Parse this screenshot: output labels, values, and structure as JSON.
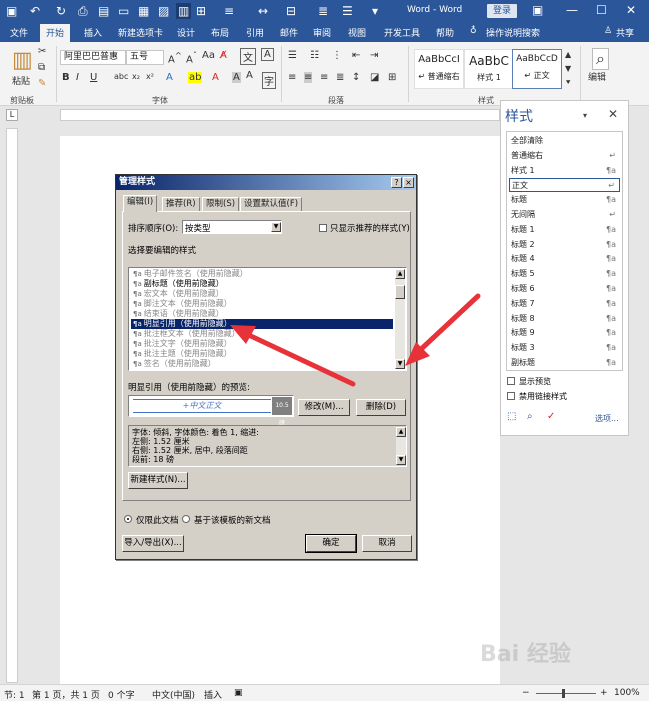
{
  "titlebar": {
    "title": "Word - Word",
    "login": "登录"
  },
  "menu": {
    "tabs": [
      "文件",
      "开始",
      "插入",
      "新建选项卡",
      "设计",
      "布局",
      "引用",
      "邮件",
      "审阅",
      "视图",
      "开发工具",
      "帮助"
    ],
    "active": "开始",
    "tell_me": "操作说明搜索",
    "share": "共享"
  },
  "ribbon": {
    "paste": "粘贴",
    "clipboard": "剪贴板",
    "font_name": "阿里巴巴普惠",
    "font_size": "五号",
    "font_group": "字体",
    "paragraph_group": "段落",
    "styles_group": "样式",
    "edit": "编辑",
    "style_gallery": [
      {
        "preview": "AaBbCcI",
        "name": "↵ 普通缩右"
      },
      {
        "preview": "AaBbC",
        "name": "样式 1"
      },
      {
        "preview": "AaBbCcD",
        "name": "↵ 正文"
      }
    ]
  },
  "styles_pane": {
    "title": "样式",
    "items": [
      {
        "label": "全部清除",
        "mark": ""
      },
      {
        "label": "普通缩右",
        "mark": "↵"
      },
      {
        "label": "样式 1",
        "mark": "¶a"
      },
      {
        "label": "正文",
        "mark": "↵"
      },
      {
        "label": "标题",
        "mark": "¶a"
      },
      {
        "label": "无间隔",
        "mark": "↵"
      },
      {
        "label": "标题 1",
        "mark": "¶a"
      },
      {
        "label": "标题 2",
        "mark": "¶a"
      },
      {
        "label": "标题 4",
        "mark": "¶a"
      },
      {
        "label": "标题 5",
        "mark": "¶a"
      },
      {
        "label": "标题 6",
        "mark": "¶a"
      },
      {
        "label": "标题 7",
        "mark": "¶a"
      },
      {
        "label": "标题 8",
        "mark": "¶a"
      },
      {
        "label": "标题 9",
        "mark": "¶a"
      },
      {
        "label": "标题 3",
        "mark": "¶a"
      },
      {
        "label": "副标题",
        "mark": "¶a"
      }
    ],
    "selected_index": 3,
    "show_preview": "显示预览",
    "disable_linked": "禁用链接样式",
    "options": "选项..."
  },
  "dialog": {
    "title": "管理样式",
    "tabs": [
      "编辑(I)",
      "推荐(R)",
      "限制(S)",
      "设置默认值(F)"
    ],
    "sort_label": "排序顺序(O):",
    "sort_value": "按类型",
    "only_recommended": "只显示推荐的样式(Y)",
    "select_label": "选择要编辑的样式",
    "style_items": [
      {
        "label": "电子邮件签名（使用前隐藏）",
        "state": "grey"
      },
      {
        "label": "副标题（使用前隐藏）",
        "state": "black"
      },
      {
        "label": "宏文本（使用前隐藏）",
        "state": "grey"
      },
      {
        "label": "脚注文本（使用前隐藏）",
        "state": "grey"
      },
      {
        "label": "结束语（使用前隐藏）",
        "state": "grey"
      },
      {
        "label": "明显引用（使用前隐藏）",
        "state": "selected"
      },
      {
        "label": "批注框文本（使用前隐藏）",
        "state": "grey"
      },
      {
        "label": "批注文字（使用前隐藏）",
        "state": "grey"
      },
      {
        "label": "批注主题（使用前隐藏）",
        "state": "grey"
      },
      {
        "label": "签名（使用前隐藏）",
        "state": "grey"
      }
    ],
    "preview_label": "明显引用（使用前隐藏）的预览:",
    "preview_text": "+中文正文",
    "preview_size": "10.5 磅",
    "modify": "修改(M)...",
    "delete": "删除(D)",
    "description_lines": [
      "字体: 倾斜, 字体颜色: 着色 1, 缩进:",
      "    左侧:  1.52 厘米",
      "    右侧:  1.52 厘米, 居中, 段落间距",
      "    段前:  18 磅"
    ],
    "new_style": "新建样式(N)...",
    "only_this_doc": "仅限此文档",
    "new_docs_template": "基于该模板的新文档",
    "import_export": "导入/导出(X)...",
    "ok": "确定",
    "cancel": "取消"
  },
  "statusbar": {
    "section": "节: 1",
    "page": "第 1 页，共 1 页",
    "words": "0 个字",
    "language": "中文(中国)",
    "insert": "插入",
    "zoom": "100%"
  },
  "watermark": "Bai 经验",
  "colors": {
    "accent": "#2b579a",
    "dialog_title": "#0a246a",
    "arrow": "#e8323a"
  }
}
